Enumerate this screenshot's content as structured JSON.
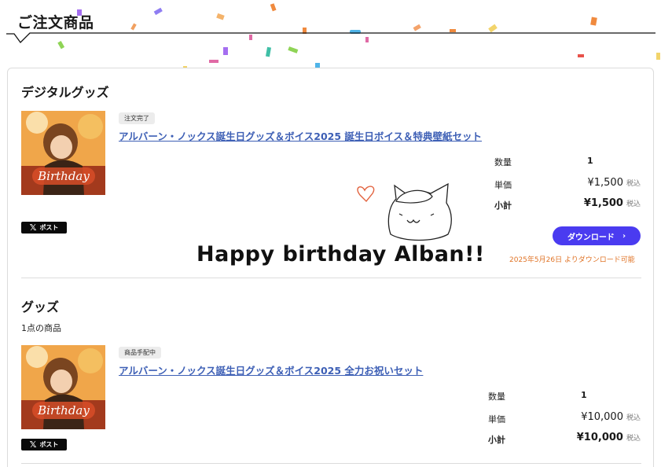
{
  "page": {
    "title": "ご注文商品"
  },
  "overlay": {
    "message": "Happy birthday Alban!!"
  },
  "sections": {
    "digital": {
      "title": "デジタルグッズ",
      "item": {
        "status": "注文完了",
        "name": "アルバーン・ノックス誕生日グッズ＆ボイス2025 誕生日ボイス＆特典壁紙セット",
        "thumbnail_text": "Birthday",
        "quantity_label": "数量",
        "quantity": "1",
        "unit_price_label": "単価",
        "unit_price": "¥1,500",
        "unit_tax": "税込",
        "subtotal_label": "小計",
        "subtotal": "¥1,500",
        "subtotal_tax": "税込",
        "post_label": "ポスト",
        "download_label": "ダウンロード",
        "download_note": "2025年5月26日 よりダウンロード可能"
      }
    },
    "goods": {
      "title": "グッズ",
      "count": "1点の商品",
      "item": {
        "status": "商品手配中",
        "name": "アルバーン・ノックス誕生日グッズ＆ボイス2025 全力お祝いセット",
        "thumbnail_text": "Birthday",
        "quantity_label": "数量",
        "quantity": "1",
        "unit_price_label": "単価",
        "unit_price": "¥10,000",
        "unit_tax": "税込",
        "subtotal_label": "小計",
        "subtotal": "¥10,000",
        "subtotal_tax": "税込",
        "post_label": "ポスト"
      }
    }
  },
  "icons": {
    "x_logo": "x-logo-icon",
    "chevron": "chevron-right-icon",
    "heart": "heart-doodle-icon",
    "cat": "cat-doodle-icon"
  },
  "colors": {
    "link": "#3d5fb5",
    "accent_button": "#4a3bf0",
    "note": "#e07427",
    "badge_bg": "#ececec"
  }
}
